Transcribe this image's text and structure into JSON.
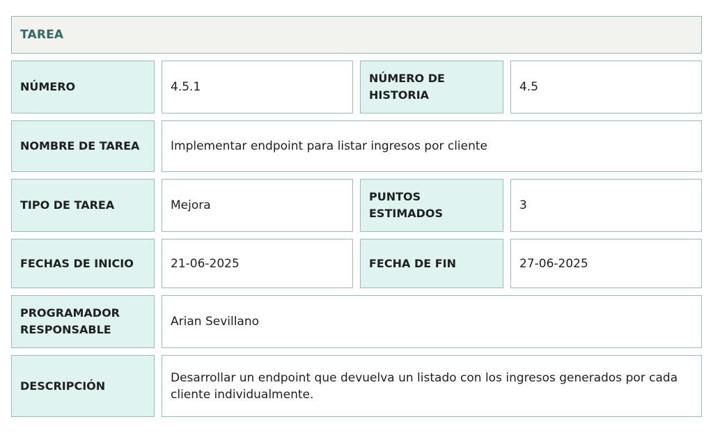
{
  "header": {
    "title": "TAREA"
  },
  "fields": {
    "numero": {
      "label": "NÚMERO",
      "value": "4.5.1"
    },
    "numero_historia": {
      "label": "NÚMERO DE HISTORIA",
      "value": "4.5"
    },
    "nombre_tarea": {
      "label": "NOMBRE DE TAREA",
      "value": "Implementar endpoint para listar ingresos por cliente"
    },
    "tipo_tarea": {
      "label": "TIPO DE TAREA",
      "value": "Mejora"
    },
    "puntos_estimados": {
      "label": "PUNTOS ESTIMADOS",
      "value": "3"
    },
    "fechas_inicio": {
      "label": "FECHAS DE INICIO",
      "value": "21-06-2025"
    },
    "fecha_fin": {
      "label": "FECHA DE FIN",
      "value": "27-06-2025"
    },
    "programador": {
      "label": "PROGRAMADOR RESPONSABLE",
      "value": "Arian Sevillano"
    },
    "descripcion": {
      "label": "DESCRIPCIÓN",
      "value": "Desarrollar un endpoint que devuelva un listado con los ingresos generados por cada cliente individualmente."
    }
  },
  "colors": {
    "border": "#8dc2bd",
    "label_bg": "#dff3f1",
    "header_bg": "#f2f2ee",
    "header_text": "#2f6b63"
  }
}
